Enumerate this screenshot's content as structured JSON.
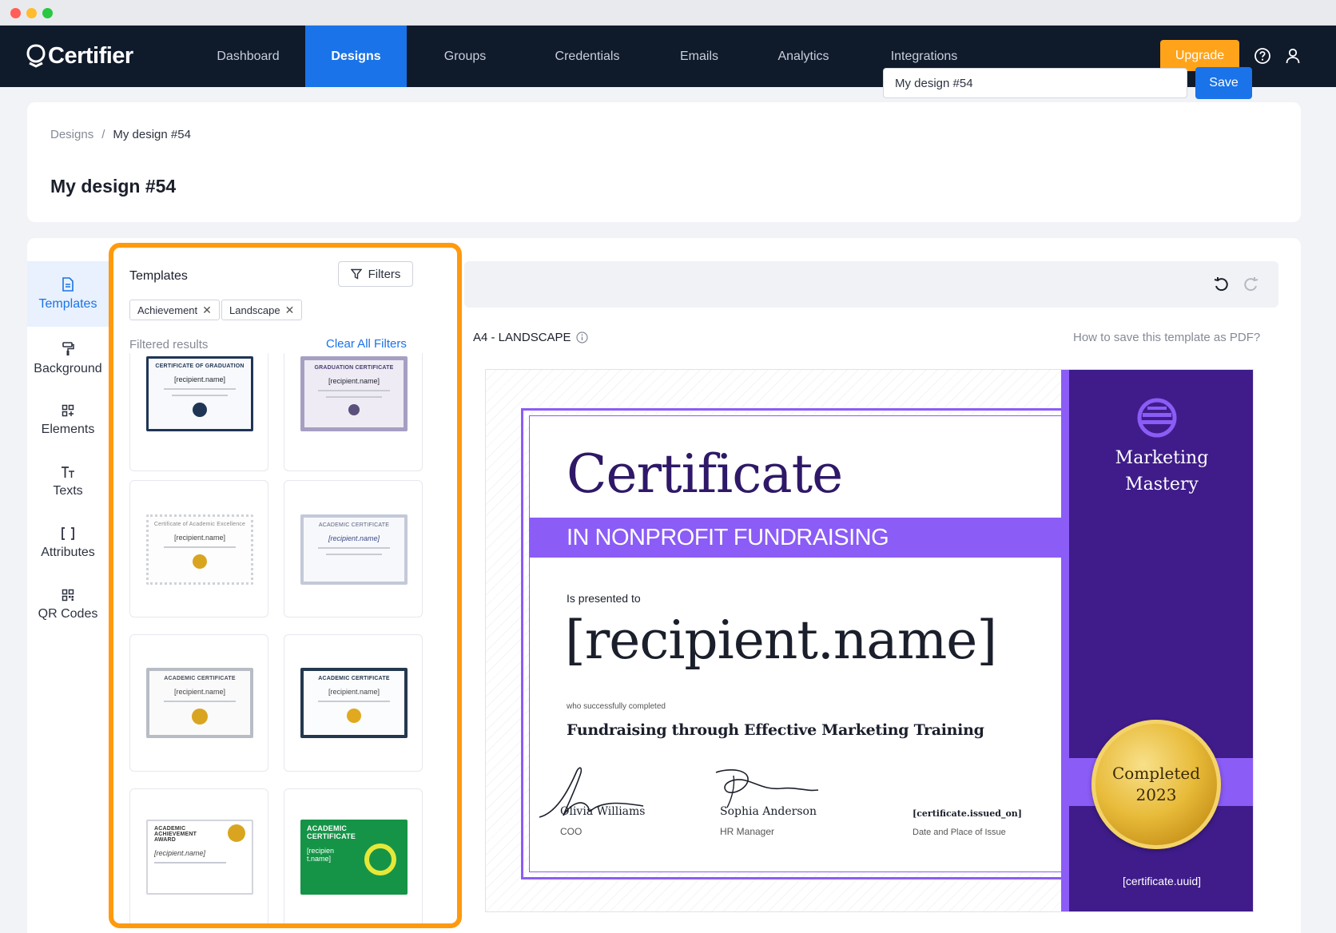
{
  "app": {
    "logo": "Certifier"
  },
  "nav": {
    "items": [
      {
        "label": "Dashboard"
      },
      {
        "label": "Designs"
      },
      {
        "label": "Groups"
      },
      {
        "label": "Credentials"
      },
      {
        "label": "Emails"
      },
      {
        "label": "Analytics"
      },
      {
        "label": "Integrations"
      }
    ],
    "active": "Designs",
    "upgrade_label": "Upgrade",
    "help_icon": "help-circle-icon",
    "user_icon": "user-icon"
  },
  "breadcrumb": {
    "root": "Designs",
    "separator": "/",
    "current": "My design #54"
  },
  "header": {
    "title": "My design #54",
    "name_input_value": "My design #54",
    "save_label": "Save"
  },
  "tools": [
    {
      "label": "Templates",
      "icon": "document-icon"
    },
    {
      "label": "Background",
      "icon": "paint-roller-icon"
    },
    {
      "label": "Elements",
      "icon": "elements-grid-icon"
    },
    {
      "label": "Texts",
      "icon": "text-icon"
    },
    {
      "label": "Attributes",
      "icon": "brackets-icon"
    },
    {
      "label": "QR Codes",
      "icon": "qr-code-icon"
    }
  ],
  "templates_panel": {
    "title": "Templates",
    "filters_label": "Filters",
    "chips": [
      {
        "label": "Achievement"
      },
      {
        "label": "Landscape"
      }
    ],
    "filtered_label": "Filtered results",
    "clear_label": "Clear All Filters",
    "thumbnails": [
      {
        "title": "CERTIFICATE OF GRADUATION",
        "name": "[recipient.name]"
      },
      {
        "title": "GRADUATION CERTIFICATE",
        "name": "[recipient.name]"
      },
      {
        "title": "Certificate of Academic Excellence",
        "name": "[recipient.name]"
      },
      {
        "title": "ACADEMIC CERTIFICATE",
        "name": "[recipient.name]"
      },
      {
        "title": "ACADEMIC CERTIFICATE",
        "name": "[recipient.name]"
      },
      {
        "title": "ACADEMIC CERTIFICATE",
        "name": "[recipient.name]"
      },
      {
        "title": "ACADEMIC ACHIEVEMENT AWARD",
        "name": "[recipient.name]"
      },
      {
        "title": "ACADEMIC CERTIFICATE",
        "name": "[recipien t.name]"
      }
    ]
  },
  "canvas": {
    "size_label": "A4 - LANDSCAPE",
    "pdf_help": "How to save this template as PDF?",
    "undo_icon": "undo-icon",
    "redo_icon": "redo-icon"
  },
  "certificate": {
    "title": "Certificate",
    "subtitle": "IN NONPROFIT FUNDRAISING",
    "presented": "Is presented to",
    "recipient": "[recipient.name]",
    "completed_text": "who successfully completed",
    "course": "Fundraising through Effective Marketing Training",
    "signatures": [
      {
        "name": "Olivia Williams",
        "role": "COO"
      },
      {
        "name": "Sophia Anderson",
        "role": "HR Manager"
      }
    ],
    "issued": "[certificate.issued_on]",
    "issued_label": "Date and Place of Issue",
    "side_title_1": "Marketing",
    "side_title_2": "Mastery",
    "seal_line_1": "Completed",
    "seal_line_2": "2023",
    "uuid": "[certificate.uuid]"
  },
  "colors": {
    "nav_bg": "#0f1a2b",
    "accent": "#1a73e8",
    "upgrade": "#ffa31a",
    "highlight_border": "#ff9a0e",
    "cert_purple": "#8b5cf6",
    "cert_dark": "#3f1c8a"
  }
}
